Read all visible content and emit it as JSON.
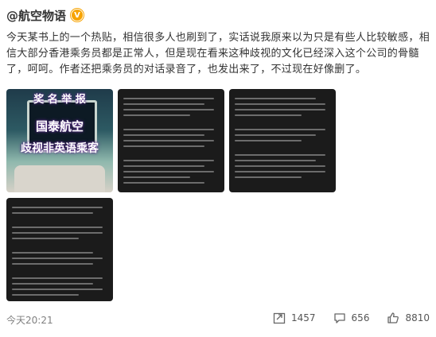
{
  "post": {
    "username": "@航空物语",
    "verified_badge": "V",
    "content": "今天某书上的一个热贴，相信很多人也刷到了，实话说我原来以为只是有些人比较敏感，相信大部分香港乘务员都是正常人，但是现在看来这种歧视的文化已经深入这个公司的骨髓了，呵呵。作者还把乘务员的对话录音了，也发出来了，不过现在好像删了。",
    "images": {
      "photo_caption_1": "奖 名 举 报",
      "photo_caption_2": "国泰航空",
      "photo_caption_3": "歧视非英语乘客"
    },
    "timestamp": "今天20:21",
    "actions": {
      "share_count": "1457",
      "comment_count": "656",
      "like_count": "8810"
    }
  },
  "colors": {
    "text": "#333333",
    "muted": "#808080",
    "badge": "#f7a300",
    "tile_bg": "#1b1b1b"
  },
  "icons": [
    "verified-badge-icon",
    "share-icon",
    "comment-icon",
    "like-icon"
  ]
}
